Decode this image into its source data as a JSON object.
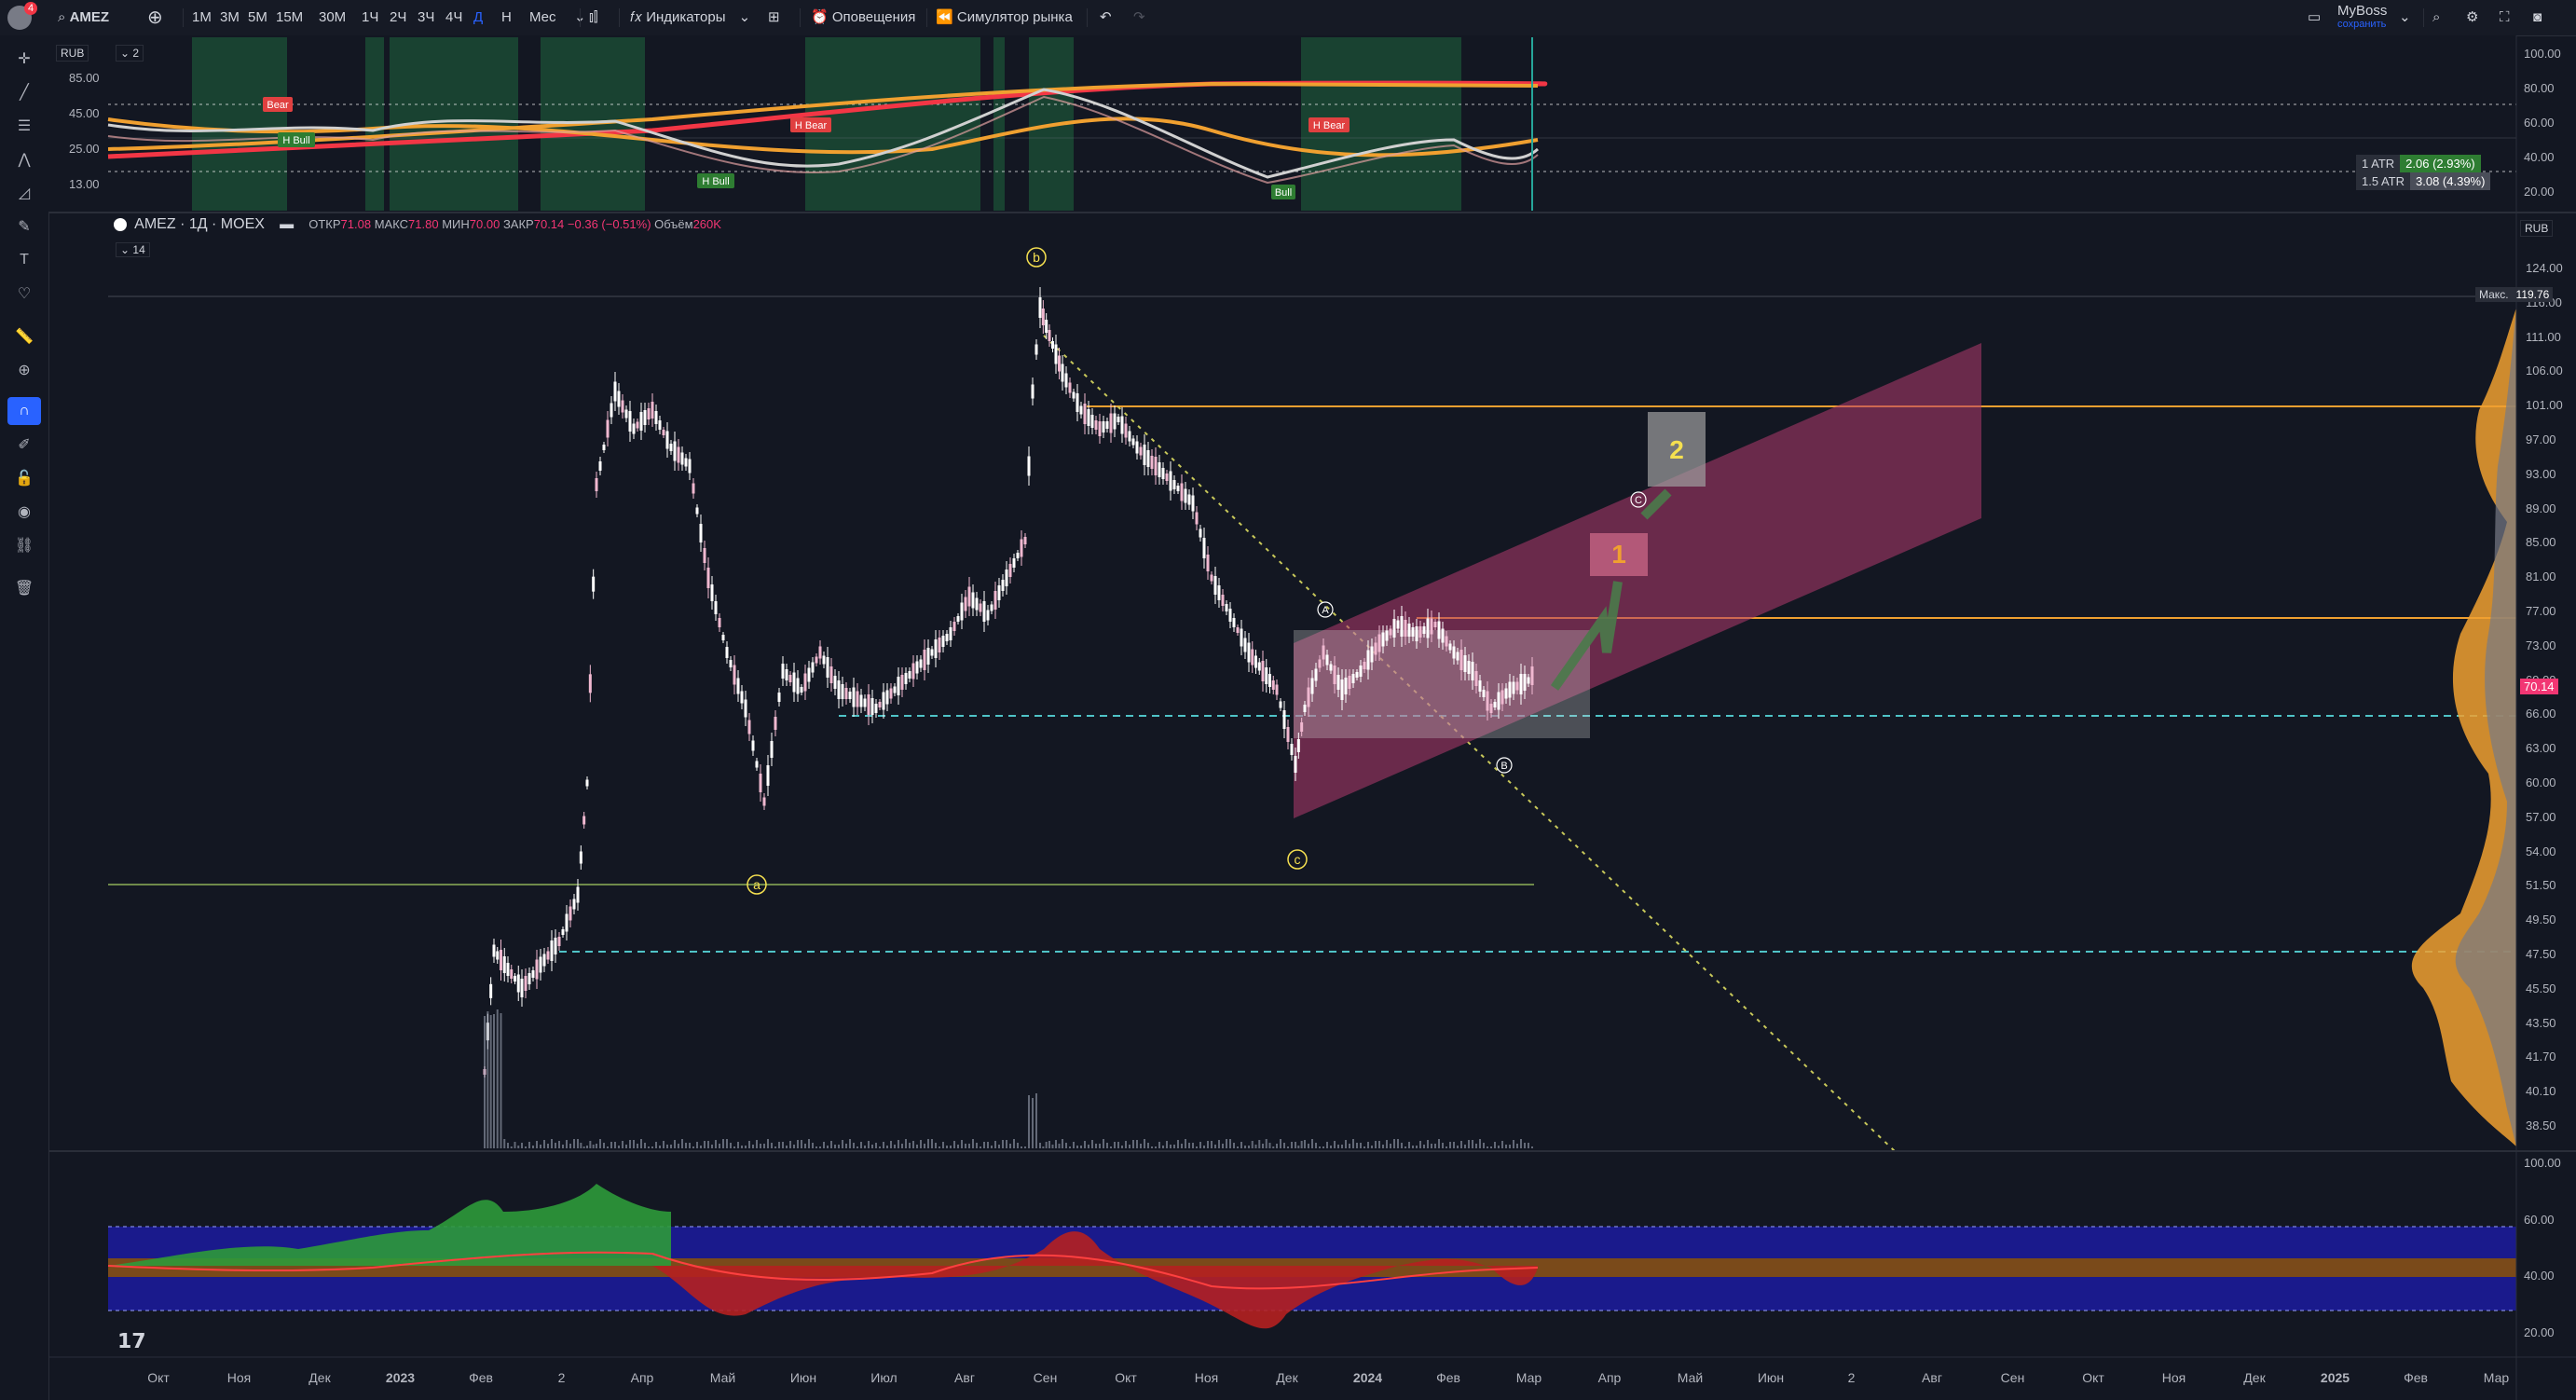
{
  "topbar": {
    "symbol": "AMEZ",
    "notification_count": "4",
    "intervals": [
      "1M",
      "3M",
      "5M",
      "15M",
      "30M",
      "1Ч",
      "2Ч",
      "3Ч",
      "4Ч",
      "Д",
      "Н",
      "Мес"
    ],
    "active_interval": "Д",
    "indicators_label": "Индикаторы",
    "alerts_label": "Оповещения",
    "replay_label": "Симулятор рынка",
    "layout_name": "MyBoss",
    "layout_status": "сохранить"
  },
  "top_pane": {
    "currency": "RUB",
    "indicator_count": "2",
    "left_scale": [
      "85.00",
      "45.00",
      "25.00",
      "13.00"
    ],
    "right_scale": [
      "100.00",
      "80.00",
      "60.00",
      "40.00",
      "20.00"
    ],
    "signals": {
      "bear": "Bear",
      "h_bear": "H Bear",
      "h_bull": "H Bull",
      "bull": "Bull"
    },
    "atr_rows": [
      {
        "label": "1 ATR",
        "value": "2.06 (2.93%)"
      },
      {
        "label": "1.5 ATR",
        "value": "3.08 (4.39%)"
      }
    ]
  },
  "main_pane": {
    "title": "AMEZ · 1Д · MOEX",
    "ohlc": {
      "open_label": "ОТКР",
      "open": "71.08",
      "high_label": "МАКС",
      "high": "71.80",
      "low_label": "МИН",
      "low": "70.00",
      "close_label": "ЗАКР",
      "close": "70.14",
      "change": "−0.36 (−0.51%)",
      "volume_label": "Объём",
      "volume": "260K"
    },
    "sub_indicator": "14",
    "currency": "RUB",
    "max_label": "Макс.",
    "max_price": "119.76",
    "current_price": "70.14",
    "price_scale": [
      "124.00",
      "116.00",
      "111.00",
      "106.00",
      "101.00",
      "97.00",
      "93.00",
      "89.00",
      "85.00",
      "81.00",
      "77.00",
      "73.00",
      "69.00",
      "66.00",
      "63.00",
      "60.00",
      "57.00",
      "54.00",
      "51.50",
      "49.50",
      "47.50",
      "45.50",
      "43.50",
      "41.70",
      "40.10",
      "38.50"
    ],
    "wave_labels": {
      "a": "a",
      "b": "b",
      "c1": "c",
      "c2": "c",
      "A": "A",
      "B": "B",
      "C": "C"
    },
    "targets": [
      "1",
      "2"
    ]
  },
  "osc_pane": {
    "scale": [
      "100.00",
      "60.00",
      "40.00",
      "20.00"
    ]
  },
  "time_axis": [
    "Окт",
    "Ноя",
    "Дек",
    "2023",
    "Фев",
    "2",
    "Апр",
    "Май",
    "Июн",
    "Июл",
    "Авг",
    "Сен",
    "Окт",
    "Ноя",
    "Дек",
    "2024",
    "Фев",
    "Мар",
    "Апр",
    "Май",
    "Июн",
    "2",
    "Авг",
    "Сен",
    "Окт",
    "Ноя",
    "Дек",
    "2025",
    "Фев",
    "Мар"
  ],
  "colors": {
    "background": "#131722",
    "channel": "#b23a6e",
    "orange_line": "#f0a030",
    "dashed_cyan": "#4fc3c7",
    "price_tag": "#f23673",
    "blue_band": "#1a1a8c",
    "brown_band": "#7a4a1a"
  }
}
